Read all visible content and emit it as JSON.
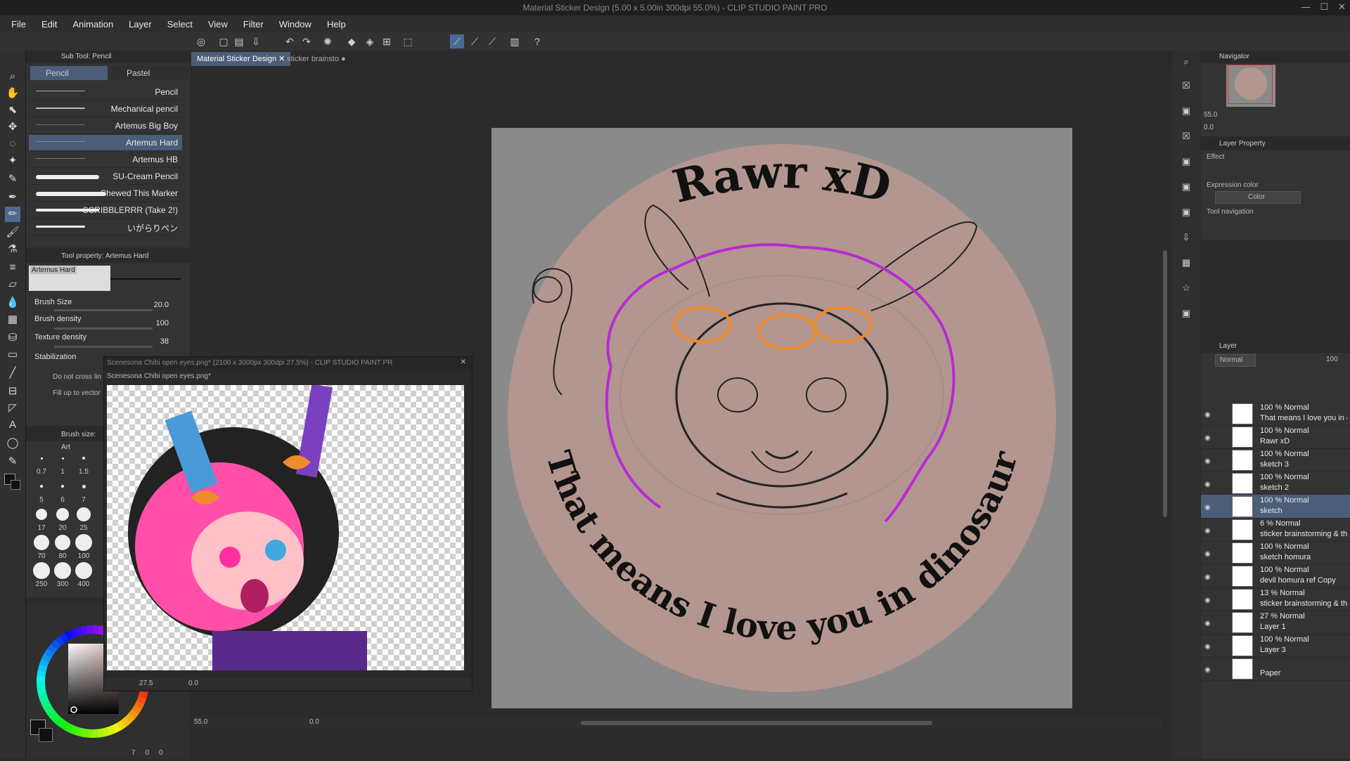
{
  "app": {
    "title": "Material Sticker Design (5.00 x 5.00in 300dpi 55.0%) - CLIP STUDIO PAINT PRO",
    "window_buttons": [
      "—",
      "☐",
      "✕"
    ]
  },
  "menu": [
    "File",
    "Edit",
    "Animation",
    "Layer",
    "Select",
    "View",
    "Filter",
    "Window",
    "Help"
  ],
  "subtool": {
    "header": "Sub Tool: Pencil",
    "tabs": [
      "Pencil",
      "Pastel"
    ],
    "brushes": [
      "Pencil",
      "Mechanical pencil",
      "Artemus Big Boy",
      "Artemus Hard",
      "Artemus HB",
      "SU-Cream Pencil",
      "Chewed This Marker",
      "SCRIBBLERRR (Take 2!)",
      "いがらりペン"
    ],
    "selected_index": 3
  },
  "tool_property": {
    "header": "Tool property: Artemus Hard",
    "preview_label": "Artemus Hard",
    "brush_size_label": "Brush Size",
    "brush_size_value": "20.0",
    "brush_density_label": "Brush density",
    "brush_density_value": "100",
    "texture_density_label": "Texture density",
    "texture_density_value": "38",
    "stabilization_label": "Stabilization",
    "do_not_cross_label": "Do not cross lin",
    "fill_up_label": "Fill up to vector"
  },
  "brush_size_panel": {
    "header": "Brush size: Art",
    "sizes": [
      "0.7",
      "1",
      "1.5",
      "5",
      "6",
      "7",
      "17",
      "20",
      "25",
      "70",
      "80",
      "100",
      "250",
      "300",
      "400"
    ]
  },
  "color_wheel": {
    "bottom_values": [
      "7",
      "0",
      "0"
    ]
  },
  "doc_tabs": [
    "Material Sticker Design",
    "sticker brainsto"
  ],
  "canvas": {
    "top_text": "Rawr xD",
    "bottom_text": "That means I love you in dinosaur",
    "zoom": "55.0",
    "angle": "0.0",
    "colors": {
      "circle": "#b39690",
      "purple": "#b82ad4",
      "orange": "#f08a2a"
    }
  },
  "subwindow": {
    "title": "Scenesona Chibi open eyes.png* (2100 x 3000px 300dpi 27.5%) - CLIP STUDIO PAINT PR",
    "tab": "Scenesona Chibi open eyes.png*",
    "zoom": "27.5",
    "angle": "0.0"
  },
  "navigator": {
    "header": "Navigator",
    "zoom": "55.0",
    "angle": "0.0"
  },
  "layer_property": {
    "header": "Layer Property",
    "effect_label": "Effect",
    "expression_color_label": "Expression color",
    "expression_color_value": "Color",
    "tool_nav_label": "Tool navigation"
  },
  "layer_panel": {
    "header": "Layer",
    "blend_mode": "Normal",
    "opacity": "100",
    "layers": [
      {
        "mode": "100 % Normal",
        "name": "That means I love you in dinosaur"
      },
      {
        "mode": "100 % Normal",
        "name": "Rawr xD"
      },
      {
        "mode": "100 % Normal",
        "name": "sketch 3"
      },
      {
        "mode": "100 % Normal",
        "name": "sketch 2"
      },
      {
        "mode": "100 % Normal",
        "name": "sketch"
      },
      {
        "mode": "6 % Normal",
        "name": "sticker brainstorming & thumbn"
      },
      {
        "mode": "100 % Normal",
        "name": "sketch homura"
      },
      {
        "mode": "100 % Normal",
        "name": "devil homura ref Copy"
      },
      {
        "mode": "13 % Normal",
        "name": "sticker brainstorming & thumbn"
      },
      {
        "mode": "27 % Normal",
        "name": "Layer 1"
      },
      {
        "mode": "100 % Normal",
        "name": "Layer 3"
      },
      {
        "mode": "",
        "name": "Paper"
      }
    ],
    "selected_index": 4
  }
}
